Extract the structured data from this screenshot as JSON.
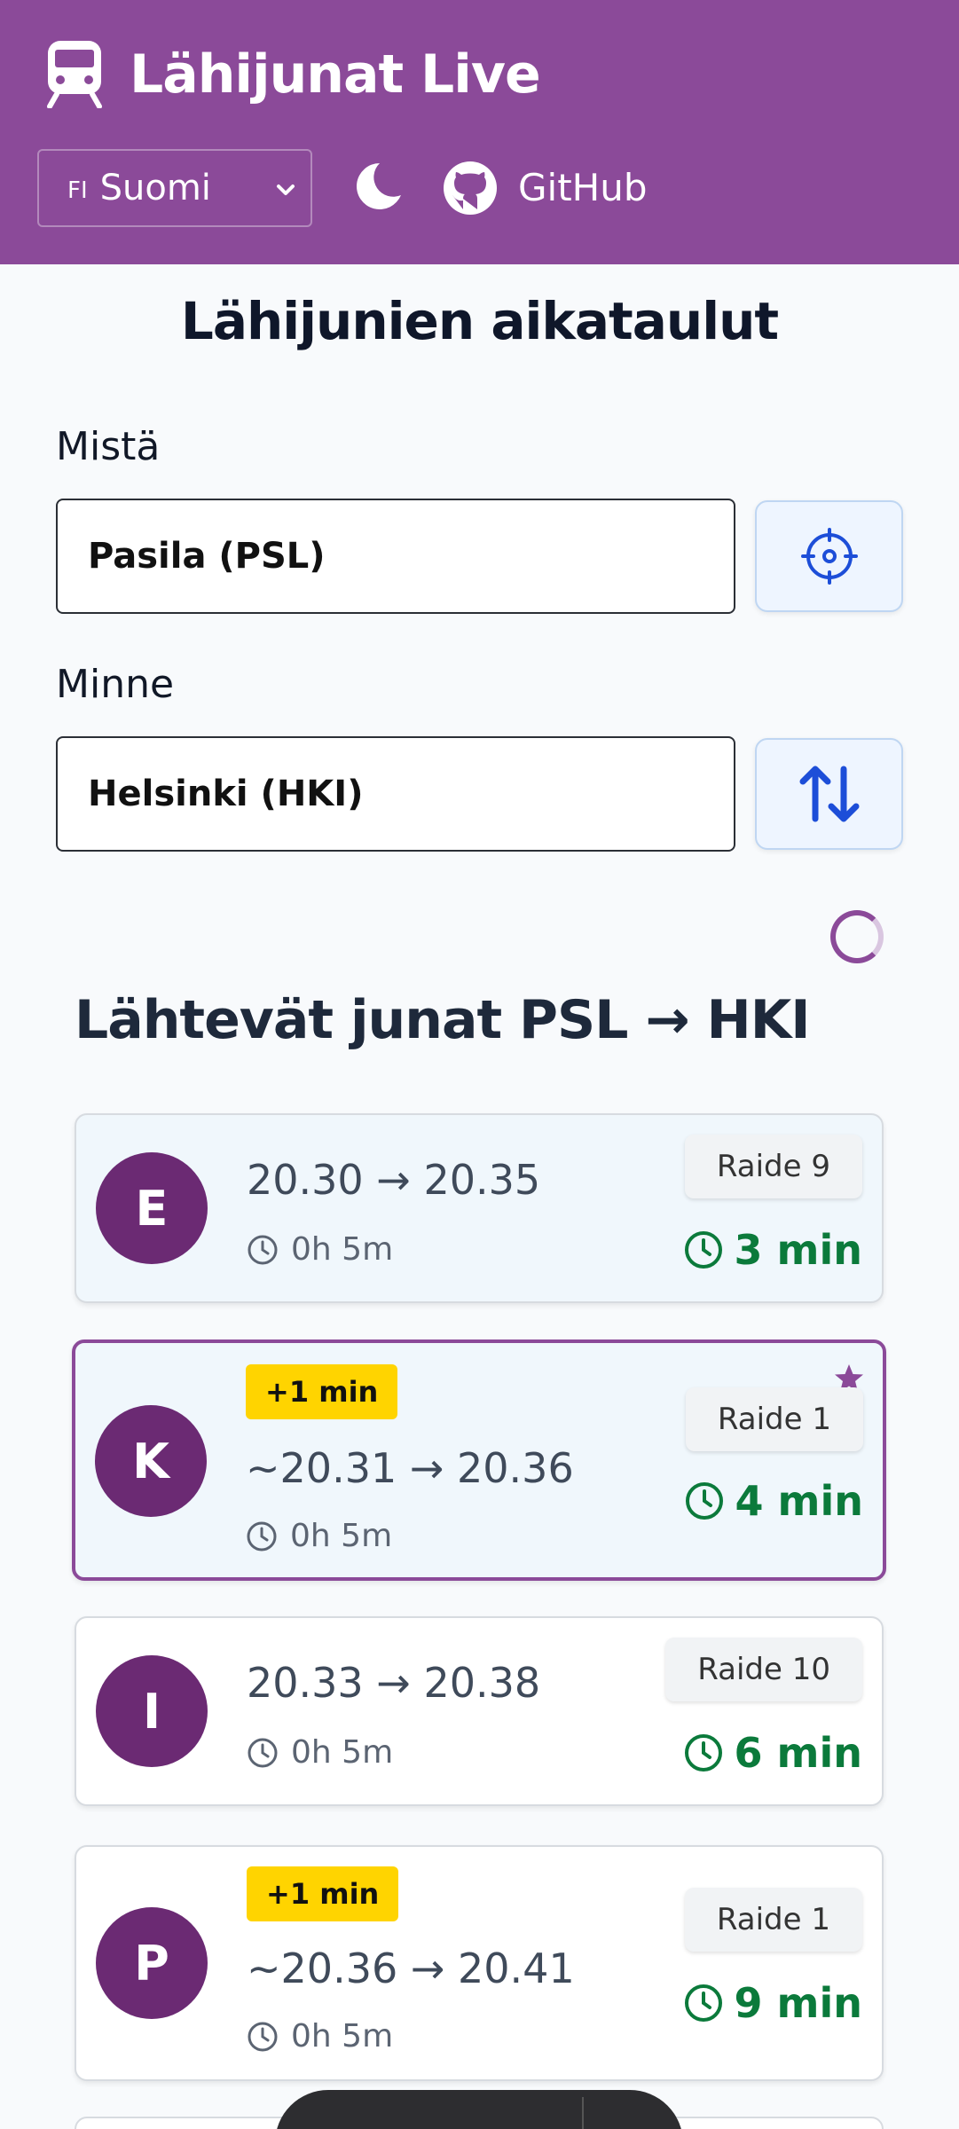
{
  "header": {
    "title": "Lähijunat Live",
    "lang_flag": "FI",
    "lang_label": "Suomi",
    "github_label": "GitHub",
    "bg_color": "#8b4a99"
  },
  "page_title": "Lähijunien aikataulut",
  "from": {
    "label": "Mistä",
    "value": "Pasila (PSL)"
  },
  "to": {
    "label": "Minne",
    "value": "Helsinki (HKI)"
  },
  "section_title": "Lähtevät junat PSL → HKI",
  "trains": [
    {
      "line": "E",
      "delay": "",
      "times": "20.30 → 20.35",
      "duration": "0h 5m",
      "track": "Raide 9",
      "minutes": "3 min"
    },
    {
      "line": "K",
      "delay": "+1 min",
      "times": "~20.31 → 20.36",
      "duration": "0h 5m",
      "track": "Raide 1",
      "minutes": "4 min",
      "favorite": true
    },
    {
      "line": "I",
      "delay": "",
      "times": "20.33 → 20.38",
      "duration": "0h 5m",
      "track": "Raide 10",
      "minutes": "6 min"
    },
    {
      "line": "P",
      "delay": "+1 min",
      "times": "~20.36 → 20.41",
      "duration": "0h 5m",
      "track": "Raide 1",
      "minutes": "9 min"
    }
  ],
  "icons": [
    "train-icon",
    "chevron-down-icon",
    "moon-icon",
    "github-icon",
    "locate-icon",
    "swap-icon",
    "clock-icon",
    "star-icon"
  ],
  "colors": {
    "accent": "#8b4a99",
    "badge": "#6b2a73",
    "minutes": "#0b7a3b",
    "delay": "#ffd400",
    "button_icon": "#1d4ed8"
  }
}
